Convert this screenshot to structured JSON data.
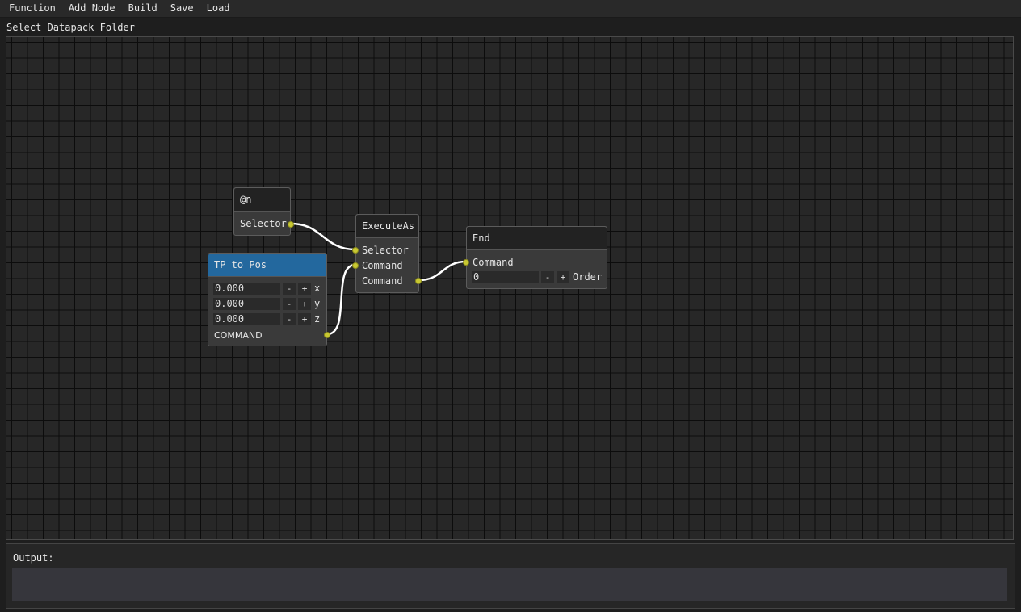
{
  "menu": [
    "Function",
    "Add Node",
    "Build",
    "Save",
    "Load"
  ],
  "toolbar": {
    "select_folder": "Select Datapack Folder"
  },
  "nodes": {
    "selector_at": {
      "title": "@n",
      "output": "Selector"
    },
    "tp_to_pos": {
      "title": "TP to Pos",
      "fields": [
        {
          "value": "0.000",
          "axis": "x"
        },
        {
          "value": "0.000",
          "axis": "y"
        },
        {
          "value": "0.000",
          "axis": "z"
        }
      ],
      "minus": "-",
      "plus": "+",
      "output": "COMMAND"
    },
    "execute_as": {
      "title": "ExecuteAs",
      "in_selector": "Selector",
      "in_command": "Command",
      "out_command": "Command"
    },
    "end": {
      "title": "End",
      "in_command": "Command",
      "order_value": "0",
      "minus": "-",
      "plus": "+",
      "order_label": "Order"
    }
  },
  "output": {
    "label": "Output:",
    "text": ""
  },
  "colors": {
    "accent": "#23689e",
    "pin": "#c8c832",
    "link": "#ffffff",
    "grid": "#0c0c0c",
    "canvas": "#272727"
  },
  "icons": {
    "pin": "pin-dot"
  }
}
